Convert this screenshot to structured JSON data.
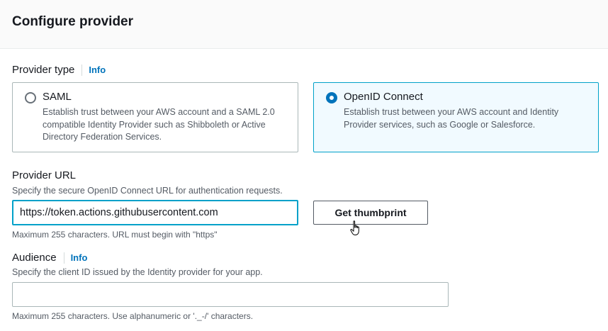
{
  "header": {
    "title": "Configure provider"
  },
  "provider_type": {
    "label": "Provider type",
    "info": "Info",
    "options": [
      {
        "title": "SAML",
        "description": "Establish trust between your AWS account and a SAML 2.0 compatible Identity Provider such as Shibboleth or Active Directory Federation Services.",
        "selected": false
      },
      {
        "title": "OpenID Connect",
        "description": "Establish trust between your AWS account and Identity Provider services, such as Google or Salesforce.",
        "selected": true
      }
    ]
  },
  "provider_url": {
    "label": "Provider URL",
    "description": "Specify the secure OpenID Connect URL for authentication requests.",
    "value": "https://token.actions.githubusercontent.com",
    "constraint": "Maximum 255 characters. URL must begin with \"https\"",
    "button_label": "Get thumbprint"
  },
  "audience": {
    "label": "Audience",
    "info": "Info",
    "description": "Specify the client ID issued by the Identity provider for your app.",
    "value": "",
    "constraint": "Maximum 255 characters. Use alphanumeric or '._-/' characters."
  },
  "colors": {
    "accent": "#0073bb",
    "focus": "#00a1c9",
    "selected_bg": "#f1faff"
  },
  "icons": {
    "cursor": "hand-pointer-icon"
  }
}
